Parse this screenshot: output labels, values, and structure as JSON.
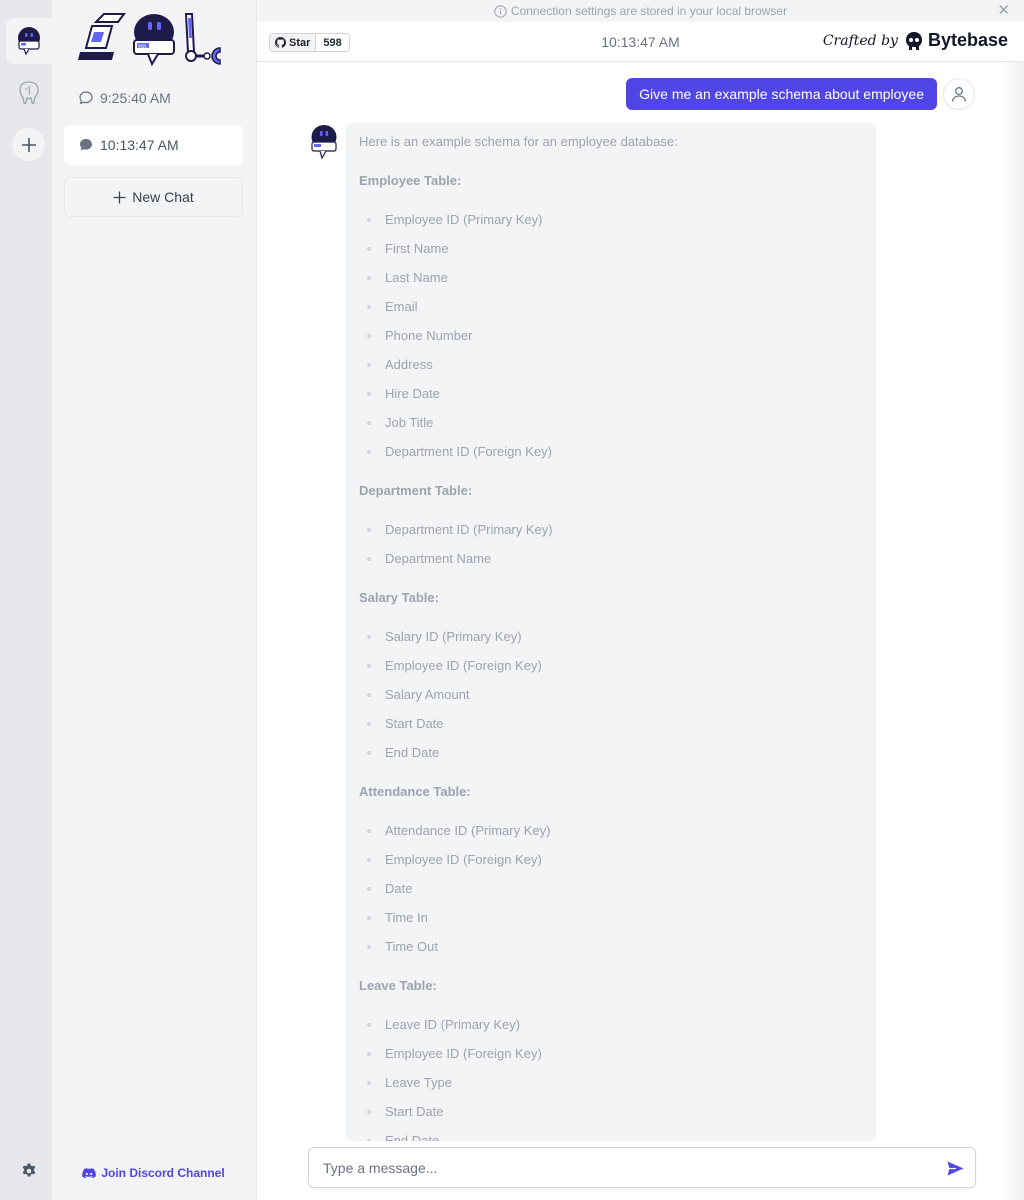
{
  "banner": {
    "text": "Connection settings are stored in your local browser"
  },
  "sidebar": {
    "chats": [
      {
        "label": "9:25:40 AM"
      },
      {
        "label": "10:13:47 AM"
      }
    ],
    "new_chat_label": "New Chat",
    "discord_label": "Join Discord Channel",
    "logo_text": "SQL"
  },
  "header": {
    "star_label": "Star",
    "star_count": "598",
    "title": "10:13:47 AM",
    "crafted_by": "Crafted by",
    "brand": "Bytebase"
  },
  "conversation": {
    "user_message": "Give me an example schema about employee",
    "bot_intro": "Here is an example schema for an employee database:",
    "sections": [
      {
        "title": "Employee Table:",
        "items": [
          "Employee ID (Primary Key)",
          "First Name",
          "Last Name",
          "Email",
          "Phone Number",
          "Address",
          "Hire Date",
          "Job Title",
          "Department ID (Foreign Key)"
        ]
      },
      {
        "title": "Department Table:",
        "items": [
          "Department ID (Primary Key)",
          "Department Name"
        ]
      },
      {
        "title": "Salary Table:",
        "items": [
          "Salary ID (Primary Key)",
          "Employee ID (Foreign Key)",
          "Salary Amount",
          "Start Date",
          "End Date"
        ]
      },
      {
        "title": "Attendance Table:",
        "items": [
          "Attendance ID (Primary Key)",
          "Employee ID (Foreign Key)",
          "Date",
          "Time In",
          "Time Out"
        ]
      },
      {
        "title": "Leave Table:",
        "items": [
          "Leave ID (Primary Key)",
          "Employee ID (Foreign Key)",
          "Leave Type",
          "Start Date",
          "End Date"
        ]
      }
    ]
  },
  "composer": {
    "placeholder": "Type a message..."
  },
  "colors": {
    "accent": "#4f46e5",
    "rail": "#e5e7eb",
    "sidebar": "#f3f4f6",
    "bubble": "#f3f4f6"
  }
}
